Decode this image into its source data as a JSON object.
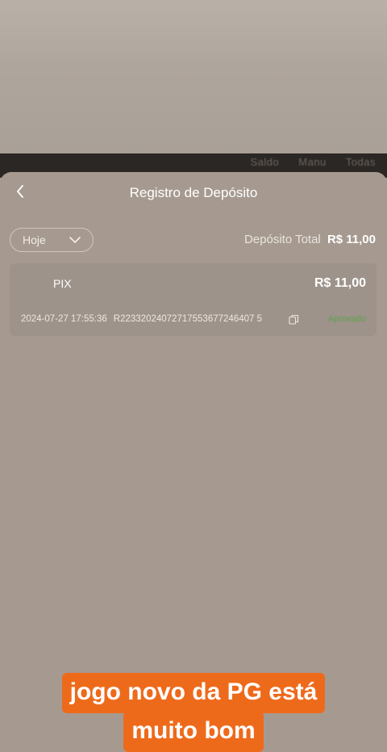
{
  "background": {
    "strip_tabs": [
      "Saldo",
      "Manu",
      "Todas"
    ]
  },
  "header": {
    "back_icon": "chevron-left-icon",
    "title": "Registro de Depósito"
  },
  "filter": {
    "selected": "Hoje",
    "icon": "chevron-down-icon"
  },
  "summary": {
    "total_label": "Depósito Total",
    "total_value": "R$ 11,00"
  },
  "records": [
    {
      "method": "PIX",
      "amount": "R$ 11,00",
      "datetime": "2024-07-27 17:55:36",
      "order_id": "R22332024072717553677246407 5",
      "status": "Aprovado"
    }
  ],
  "caption": {
    "line1": "jogo novo da PG está",
    "line2": "muito bom"
  },
  "colors": {
    "background": "#a69a90",
    "status_success": "#5fa14a",
    "caption_bg": "#ee6a1b"
  }
}
